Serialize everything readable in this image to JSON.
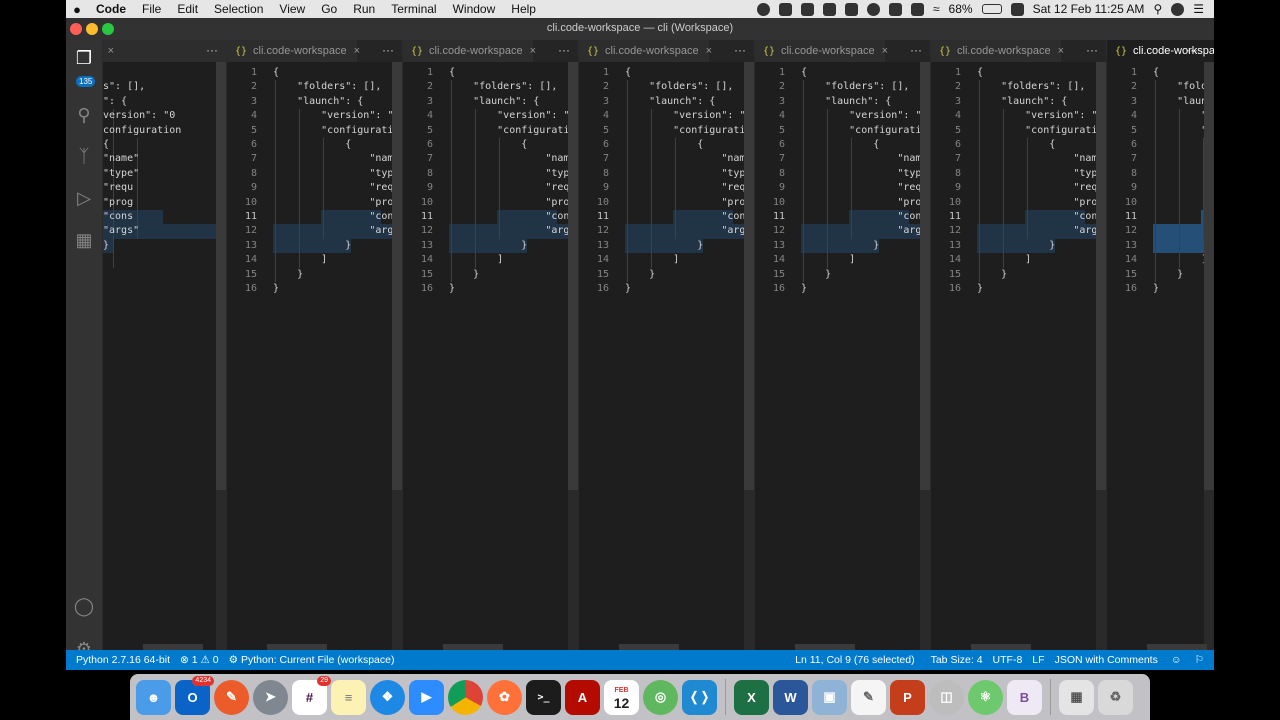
{
  "menubar": {
    "apple": "",
    "app_name": "Code",
    "items": [
      "File",
      "Edit",
      "Selection",
      "View",
      "Go",
      "Run",
      "Terminal",
      "Window",
      "Help"
    ],
    "battery": "68%",
    "datetime": "Sat 12 Feb  11:25 AM"
  },
  "window": {
    "title": "cli.code-workspace — cli (Workspace)"
  },
  "activity_bar": {
    "explorer_badge": "135"
  },
  "editor": {
    "tab_label": "cli.code-workspace",
    "tab_label_active": "cli.code-workspace",
    "more_label": "···",
    "line_numbers": [
      "1",
      "2",
      "3",
      "4",
      "5",
      "6",
      "7",
      "8",
      "9",
      "10",
      "11",
      "12",
      "13",
      "14",
      "15",
      "16"
    ],
    "first_group_lines": [
      "",
      "s\": [],",
      "\": {",
      "version\": \"0",
      "configuration",
      "{",
      "\"name\"",
      "\"type\"",
      "\"requ",
      "\"prog",
      "\"cons",
      "\"args\"",
      "}",
      "",
      "",
      ""
    ],
    "lines": [
      "{",
      "    \"folders\": [],",
      "    \"launch\": {",
      "        \"version\": \"0",
      "        \"configuration",
      "            {",
      "                \"name\"",
      "                \"type\"",
      "                \"requ",
      "                \"prog",
      "                \"cons",
      "                \"args\"",
      "            }",
      "        ]",
      "    }",
      "}"
    ]
  },
  "statusbar": {
    "python": "Python 2.7.16 64-bit",
    "problems": "⊗ 1 ⚠ 0",
    "launch": "Python: Current File (workspace)",
    "position": "Ln 11, Col 9 (76 selected)",
    "tabsize": "Tab Size: 4",
    "encoding": "UTF-8",
    "eol": "LF",
    "language": "JSON with Comments"
  },
  "dock": {
    "outlook_badge": "4234",
    "slack_badge": "29",
    "calendar_month": "FEB",
    "calendar_day": "12"
  },
  "colors": {
    "statusbar": "#007acc",
    "selection": "#264f78",
    "editor_bg": "#1e1e1e"
  }
}
